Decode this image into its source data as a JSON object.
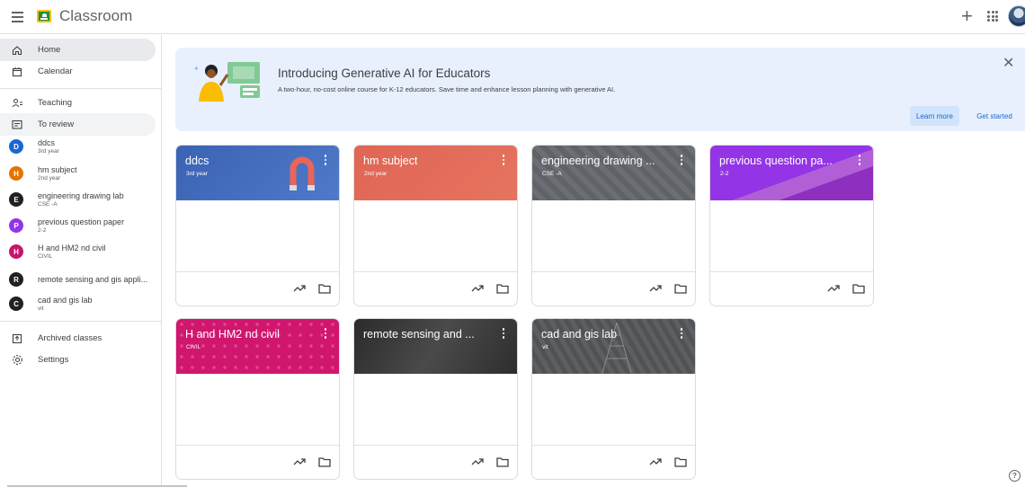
{
  "header": {
    "app_title": "Classroom",
    "menu_icon": "hamburger-menu-icon",
    "plus_icon": "plus-icon",
    "apps_icon": "google-apps-grid-icon",
    "plus_label": "+"
  },
  "sidebar": {
    "home": "Home",
    "calendar": "Calendar",
    "teaching": "Teaching",
    "to_review": "To review",
    "archived": "Archived classes",
    "settings": "Settings",
    "classes": [
      {
        "initial": "D",
        "name": "ddcs",
        "sub": "3rd year",
        "color": "#1967d2"
      },
      {
        "initial": "H",
        "name": "hm subject",
        "sub": "2nd year",
        "color": "#e37400"
      },
      {
        "initial": "E",
        "name": "engineering drawing lab",
        "sub": "CSE -A",
        "color": "#202124"
      },
      {
        "initial": "P",
        "name": "previous question paper",
        "sub": "2-2",
        "color": "#9334e6"
      },
      {
        "initial": "H",
        "name": "H and HM2 nd civil",
        "sub": "CIVIL",
        "color": "#c5166b"
      },
      {
        "initial": "R",
        "name": "remote sensing and gis appli...",
        "sub": "",
        "color": "#202124"
      },
      {
        "initial": "C",
        "name": "cad and gis lab",
        "sub": "vit",
        "color": "#202124"
      }
    ]
  },
  "banner": {
    "title": "Introducing Generative AI for Educators",
    "description": "A two-hour, no-cost online course for K-12 educators. Save time and enhance lesson planning with generative AI.",
    "learn_more": "Learn more",
    "get_started": "Get started",
    "close_label": "✕"
  },
  "cards": [
    {
      "title": "ddcs",
      "sub": "3rd year",
      "color": "#3b63b4"
    },
    {
      "title": "hm subject",
      "sub": "2nd year",
      "color": "#e06555"
    },
    {
      "title": "engineering drawing ...",
      "sub": "CSE -A",
      "color": "#5f6368"
    },
    {
      "title": "previous question pa...",
      "sub": "2-2",
      "color": "#a142c7"
    },
    {
      "title": "H and HM2 nd civil",
      "sub": "CIVIL",
      "color": "#d0166e"
    },
    {
      "title": "remote sensing and ...",
      "sub": "",
      "color": "#3a3a3a"
    },
    {
      "title": "cad and gis lab",
      "sub": "vit",
      "color": "#505254"
    }
  ],
  "help_label": "?"
}
